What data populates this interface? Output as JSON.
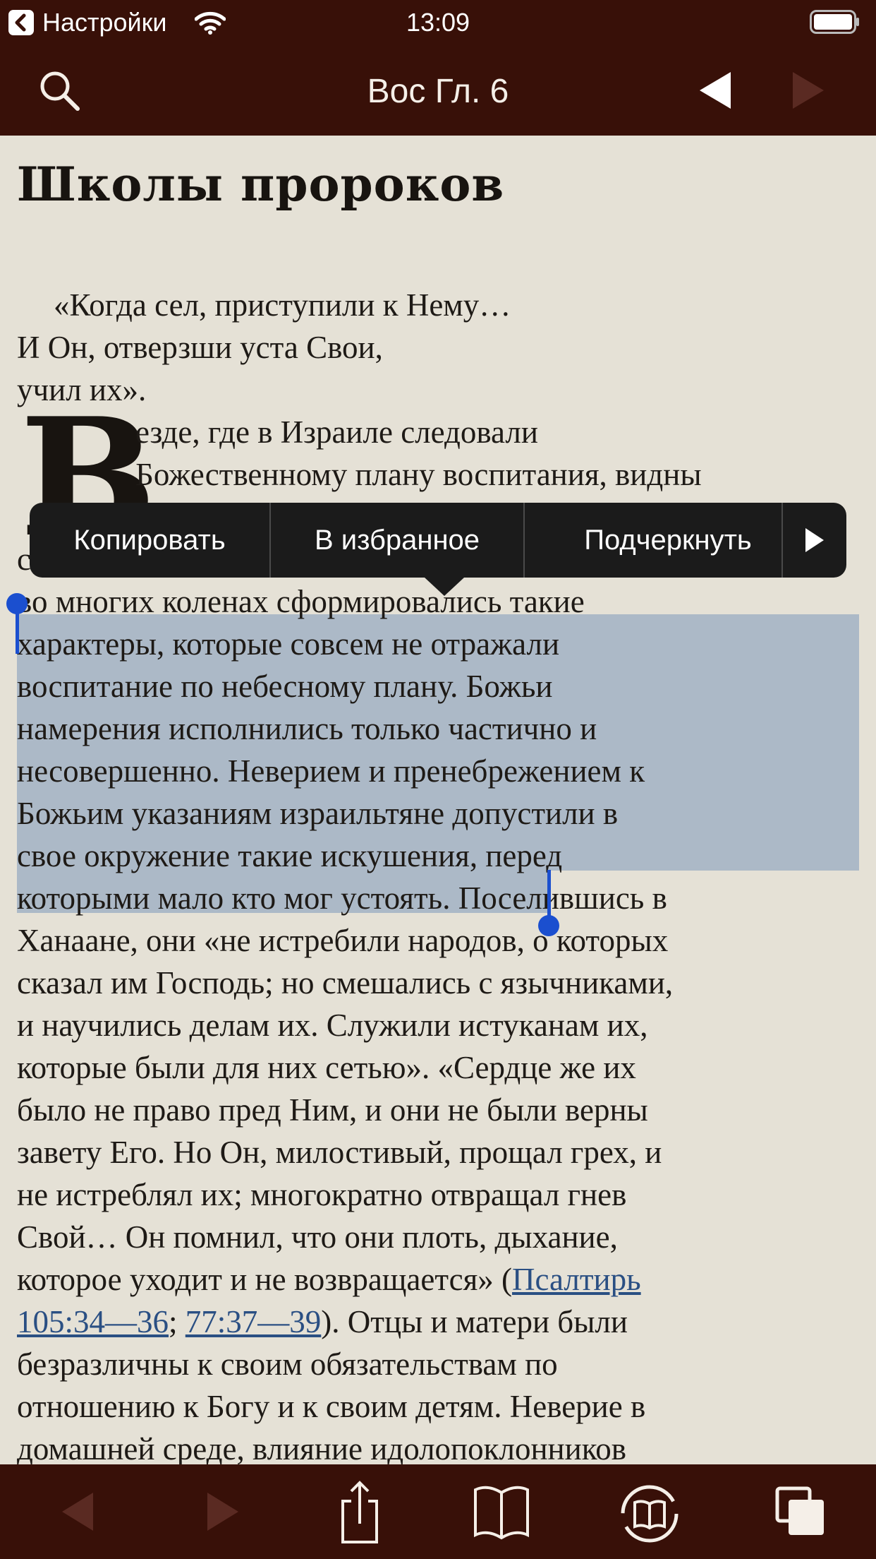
{
  "status_bar": {
    "back_app": "Настройки",
    "time": "13:09"
  },
  "nav": {
    "title": "Вос Гл. 6",
    "icons": [
      "search-icon",
      "previous-arrow-icon",
      "next-arrow-icon"
    ]
  },
  "content": {
    "heading": "Школы пророков",
    "epigraph": [
      "«Когда сел, приступили к Нему…",
      "И Он, отверзши уста Свои,",
      "учил их»."
    ],
    "drop_cap": "В",
    "dropcap_lines": [
      "езде, где в Израиле следовали",
      "Божественному плану воспитания, видны"
    ],
    "hidden_line_start": "с",
    "body_lines": [
      "во многих коленах сформировались такие",
      "характеры, которые совсем не отражали",
      "воспитание по небесному плану. Божьи",
      "намерения исполнились только частично и",
      "несовершенно. Неверием и пренебрежением к",
      "Божьим указаниям израильтяне допустили в",
      "свое окружение такие искушения, перед",
      "которыми мало кто мог устоять. Поселившись в",
      "Ханаане, они «не истребили народов, о которых",
      "сказал им Господь; но смешались с язычниками,",
      "и научились делам их. Служили истуканам их,",
      "которые были для них сетью». «Сердце же их",
      "было не право пред Ним, и они не были верны",
      "завету Его. Но Он, милостивый, прощал грех, и",
      "не истреблял их; многократно отвращал гнев",
      "Свой… Он помнил, что они плоть, дыхание,",
      "которое уходит и не возвращается» ("
    ],
    "ref_line": {
      "link1a": "Псалтирь",
      "link1b": "105:34—36",
      "sep": "; ",
      "link2": "77:37—39",
      "after": "). Отцы и матери были"
    },
    "tail_lines": [
      "безразличны к своим обязательствам по",
      "отношению к Богу и к своим детям. Неверие в",
      "домашней среде, влияние идолопоклонников"
    ]
  },
  "edit_menu": {
    "copy": "Копировать",
    "favorite": "В избранное",
    "underline": "Подчеркнуть",
    "more_icon": "play-arrow-icon"
  },
  "toolbar": {
    "icons": [
      "back-arrow-icon",
      "forward-arrow-icon",
      "share-icon",
      "book-icon",
      "sync-book-icon",
      "windows-icon"
    ]
  },
  "colors": {
    "bar": "#381008",
    "page": "#e5e1d6",
    "selection": "#5078af",
    "handle": "#1b4fcf",
    "link": "#2a4f83"
  }
}
